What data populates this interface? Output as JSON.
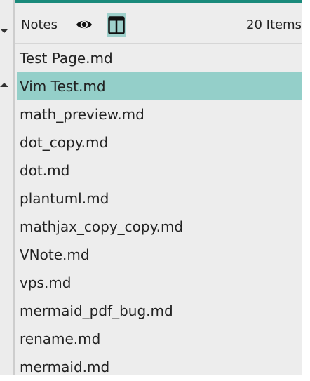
{
  "header": {
    "title": "Notes",
    "count": "20 Items",
    "eye_icon": "eye-icon",
    "view_icon": "split-view-icon"
  },
  "colors": {
    "accent": "#1a8a7b",
    "selected": "#94cfc9",
    "panel": "#ededed"
  },
  "list": {
    "selected_index": 1,
    "items": [
      "Test Page.md",
      "Vim Test.md",
      "math_preview.md",
      "dot_copy.md",
      "dot.md",
      "plantuml.md",
      "mathjax_copy_copy.md",
      "VNote.md",
      "vps.md",
      "mermaid_pdf_bug.md",
      "rename.md",
      "mermaid.md"
    ]
  }
}
